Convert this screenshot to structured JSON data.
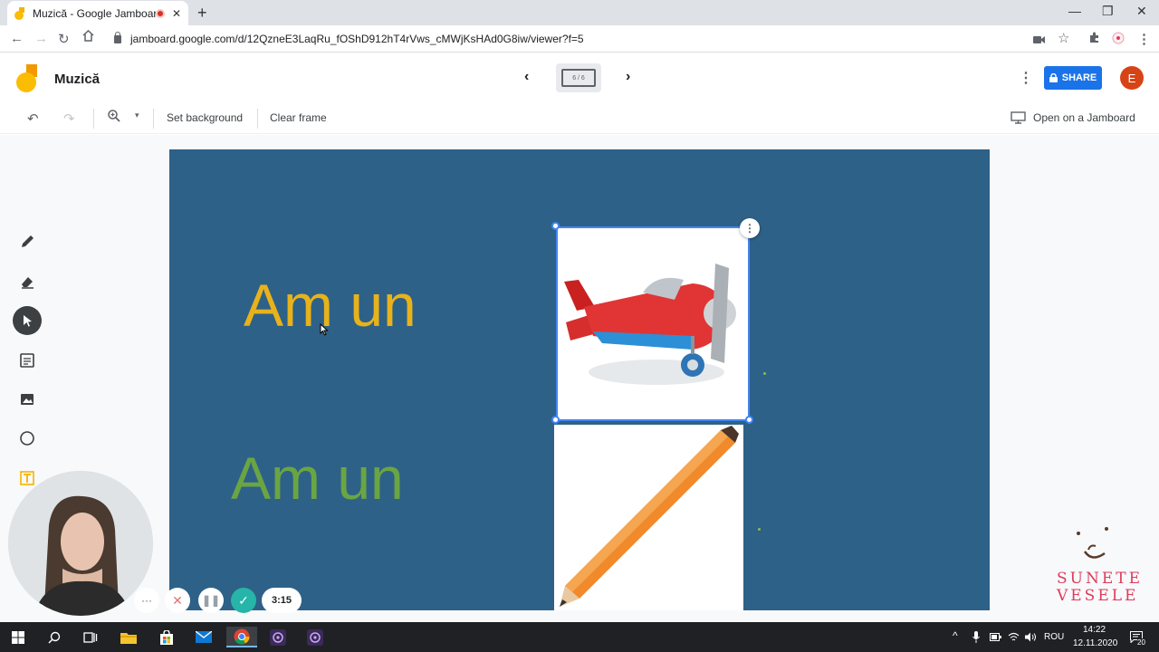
{
  "browser": {
    "tab_title": "Muzică - Google Jamboard",
    "url": "jamboard.google.com/d/12QzneE3LaqRu_fOShD912hT4rVws_cMWjKsHAd0G8iw/viewer?f=5"
  },
  "header": {
    "doc_title": "Muzică",
    "frame_indicator": "6 / 6",
    "share_label": "SHARE",
    "avatar_initial": "E"
  },
  "toolbar": {
    "set_background": "Set background",
    "clear_frame": "Clear frame",
    "open_on_jamboard": "Open on a Jamboard"
  },
  "canvas": {
    "background_color": "#2e6187",
    "text_yellow": "Am  un",
    "text_green": "Am  un",
    "images": [
      "airplane-image",
      "pencil-image"
    ]
  },
  "tools": [
    "pen-icon",
    "eraser-icon",
    "select-icon",
    "sticky-note-icon",
    "image-icon",
    "circle-icon",
    "text-box-icon"
  ],
  "recorder": {
    "time": "3:15"
  },
  "brand": {
    "line1": "SUNETE",
    "line2": "VESELE"
  },
  "taskbar": {
    "language": "ROU",
    "time": "14:22",
    "date": "12.11.2020",
    "notifications": "20"
  },
  "colors": {
    "accent": "#1a73e8",
    "canvas": "#2e6187",
    "text_yellow": "#e8b21a",
    "text_green": "#6aa544",
    "brand": "#e03a5b"
  }
}
